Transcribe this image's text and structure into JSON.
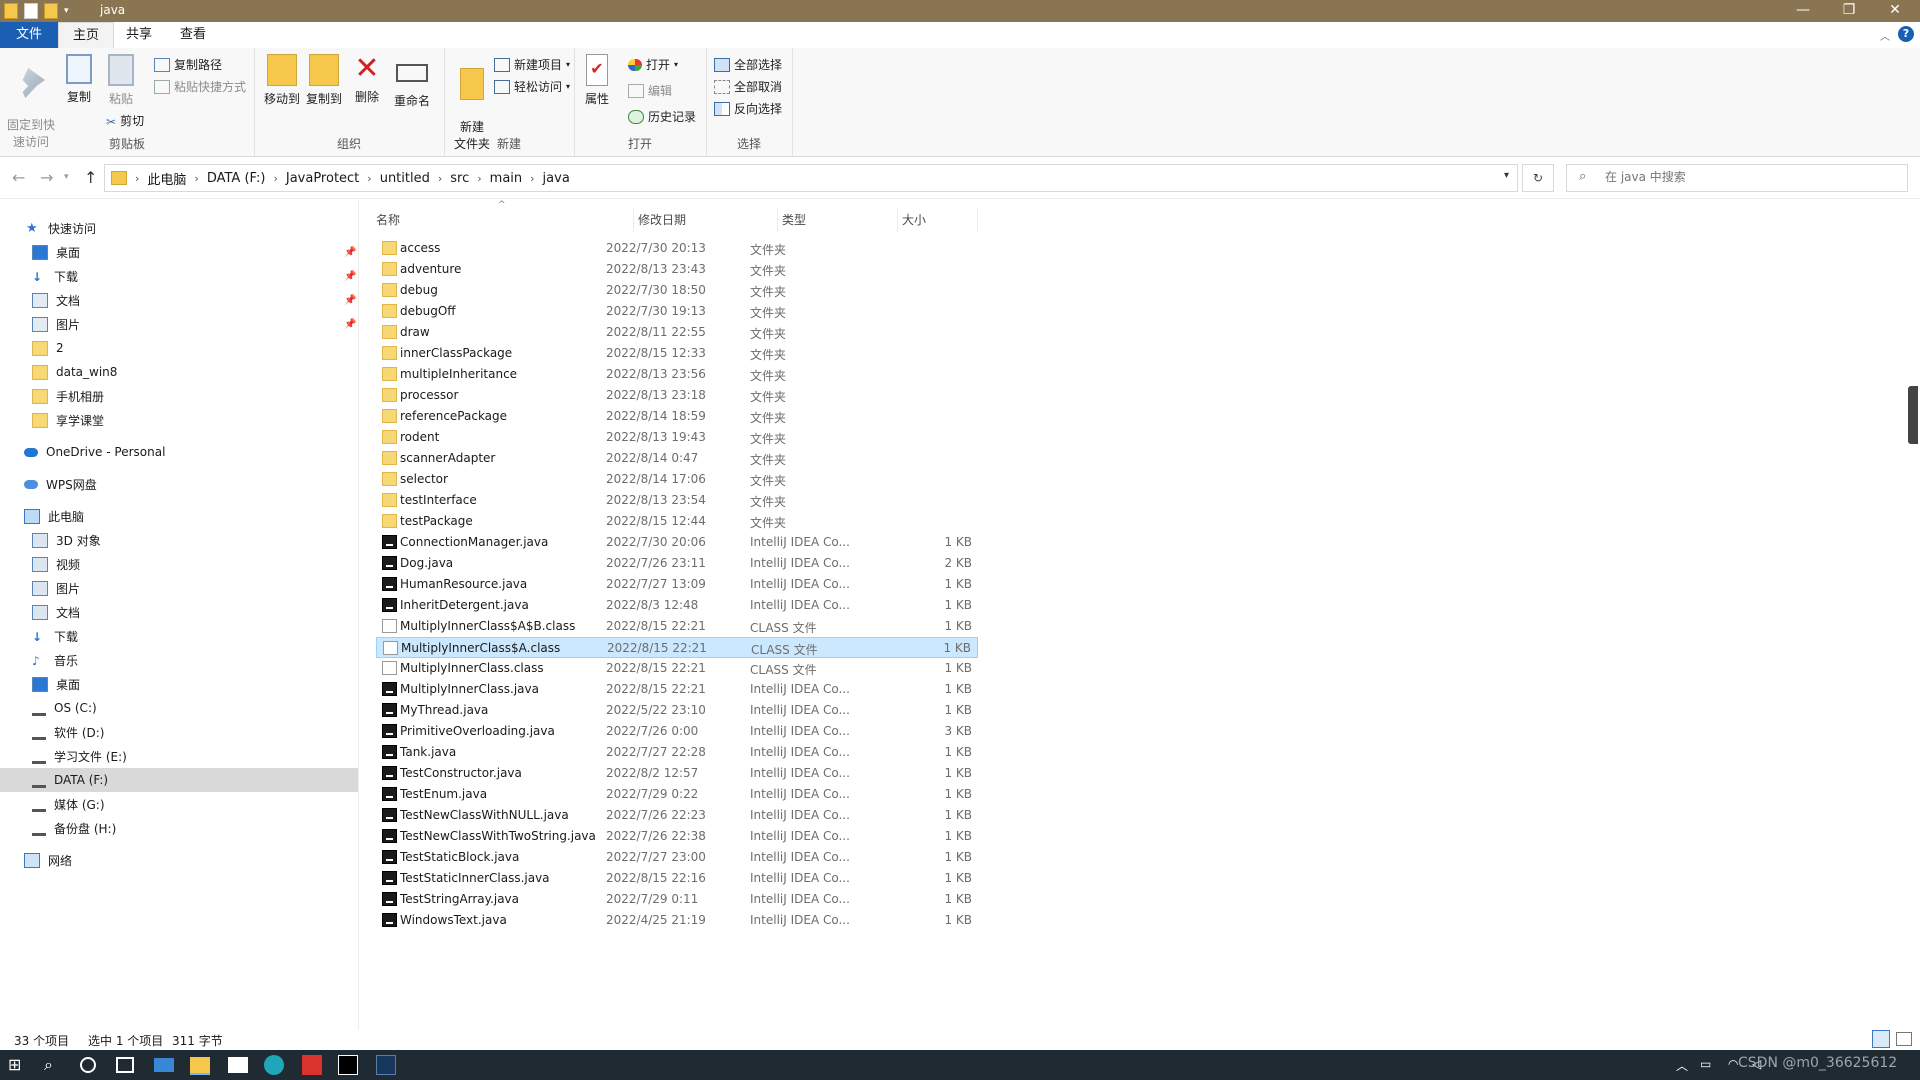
{
  "window": {
    "title": "java",
    "minimize": "—",
    "restore": "❐",
    "close": "✕"
  },
  "ribbon_tabs": [
    "文件",
    "主页",
    "共享",
    "查看"
  ],
  "ribbon": {
    "clipboard": {
      "pin": "固定到快\n速访问",
      "copy": "复制",
      "paste": "粘贴",
      "copy_path": "复制路径",
      "paste_shortcut": "粘贴快捷方式",
      "cut": "剪切",
      "label": "剪贴板"
    },
    "organize": {
      "move_to": "移动到",
      "copy_to": "复制到",
      "delete": "删除",
      "rename": "重命名",
      "label": "组织"
    },
    "new": {
      "new_folder": "新建\n文件夹",
      "new_item": "新建项目",
      "easy_access": "轻松访问",
      "label": "新建"
    },
    "open": {
      "properties": "属性",
      "open": "打开",
      "edit": "编辑",
      "history": "历史记录",
      "label": "打开"
    },
    "select": {
      "select_all": "全部选择",
      "select_none": "全部取消",
      "invert": "反向选择",
      "label": "选择"
    }
  },
  "breadcrumb": [
    "此电脑",
    "DATA (F:)",
    "JavaProtect",
    "untitled",
    "src",
    "main",
    "java"
  ],
  "search": {
    "placeholder": "在 java 中搜索"
  },
  "sidebar": {
    "quick_access": "快速访问",
    "quick_items": [
      "桌面",
      "下载",
      "文档",
      "图片",
      "2",
      "data_win8",
      "手机相册",
      "享学课堂"
    ],
    "onedrive": "OneDrive - Personal",
    "wps": "WPS网盘",
    "this_pc": "此电脑",
    "pc_items": [
      "3D 对象",
      "视频",
      "图片",
      "文档",
      "下载",
      "音乐",
      "桌面",
      "OS (C:)",
      "软件 (D:)",
      "学习文件 (E:)",
      "DATA (F:)",
      "媒体 (G:)",
      "备份盘 (H:)"
    ],
    "network": "网络"
  },
  "columns": {
    "name": "名称",
    "date": "修改日期",
    "type": "类型",
    "size": "大小"
  },
  "files": [
    {
      "name": "access",
      "date": "2022/7/30 20:13",
      "type": "文件夹",
      "size": "",
      "kind": "folder"
    },
    {
      "name": "adventure",
      "date": "2022/8/13 23:43",
      "type": "文件夹",
      "size": "",
      "kind": "folder"
    },
    {
      "name": "debug",
      "date": "2022/7/30 18:50",
      "type": "文件夹",
      "size": "",
      "kind": "folder"
    },
    {
      "name": "debugOff",
      "date": "2022/7/30 19:13",
      "type": "文件夹",
      "size": "",
      "kind": "folder"
    },
    {
      "name": "draw",
      "date": "2022/8/11 22:55",
      "type": "文件夹",
      "size": "",
      "kind": "folder"
    },
    {
      "name": "innerClassPackage",
      "date": "2022/8/15 12:33",
      "type": "文件夹",
      "size": "",
      "kind": "folder"
    },
    {
      "name": "multipleInheritance",
      "date": "2022/8/13 23:56",
      "type": "文件夹",
      "size": "",
      "kind": "folder"
    },
    {
      "name": "processor",
      "date": "2022/8/13 23:18",
      "type": "文件夹",
      "size": "",
      "kind": "folder"
    },
    {
      "name": "referencePackage",
      "date": "2022/8/14 18:59",
      "type": "文件夹",
      "size": "",
      "kind": "folder"
    },
    {
      "name": "rodent",
      "date": "2022/8/13 19:43",
      "type": "文件夹",
      "size": "",
      "kind": "folder"
    },
    {
      "name": "scannerAdapter",
      "date": "2022/8/14 0:47",
      "type": "文件夹",
      "size": "",
      "kind": "folder"
    },
    {
      "name": "selector",
      "date": "2022/8/14 17:06",
      "type": "文件夹",
      "size": "",
      "kind": "folder"
    },
    {
      "name": "testInterface",
      "date": "2022/8/13 23:54",
      "type": "文件夹",
      "size": "",
      "kind": "folder"
    },
    {
      "name": "testPackage",
      "date": "2022/8/15 12:44",
      "type": "文件夹",
      "size": "",
      "kind": "folder"
    },
    {
      "name": "ConnectionManager.java",
      "date": "2022/7/30 20:06",
      "type": "IntelliJ IDEA Co...",
      "size": "1 KB",
      "kind": "java"
    },
    {
      "name": "Dog.java",
      "date": "2022/7/26 23:11",
      "type": "IntelliJ IDEA Co...",
      "size": "2 KB",
      "kind": "java"
    },
    {
      "name": "HumanResource.java",
      "date": "2022/7/27 13:09",
      "type": "IntelliJ IDEA Co...",
      "size": "1 KB",
      "kind": "java"
    },
    {
      "name": "InheritDetergent.java",
      "date": "2022/8/3 12:48",
      "type": "IntelliJ IDEA Co...",
      "size": "1 KB",
      "kind": "java"
    },
    {
      "name": "MultiplyInnerClass$A$B.class",
      "date": "2022/8/15 22:21",
      "type": "CLASS 文件",
      "size": "1 KB",
      "kind": "class"
    },
    {
      "name": "MultiplyInnerClass$A.class",
      "date": "2022/8/15 22:21",
      "type": "CLASS 文件",
      "size": "1 KB",
      "kind": "class",
      "selected": true
    },
    {
      "name": "MultiplyInnerClass.class",
      "date": "2022/8/15 22:21",
      "type": "CLASS 文件",
      "size": "1 KB",
      "kind": "class"
    },
    {
      "name": "MultiplyInnerClass.java",
      "date": "2022/8/15 22:21",
      "type": "IntelliJ IDEA Co...",
      "size": "1 KB",
      "kind": "java"
    },
    {
      "name": "MyThread.java",
      "date": "2022/5/22 23:10",
      "type": "IntelliJ IDEA Co...",
      "size": "1 KB",
      "kind": "java"
    },
    {
      "name": "PrimitiveOverloading.java",
      "date": "2022/7/26 0:00",
      "type": "IntelliJ IDEA Co...",
      "size": "3 KB",
      "kind": "java"
    },
    {
      "name": "Tank.java",
      "date": "2022/7/27 22:28",
      "type": "IntelliJ IDEA Co...",
      "size": "1 KB",
      "kind": "java"
    },
    {
      "name": "TestConstructor.java",
      "date": "2022/8/2 12:57",
      "type": "IntelliJ IDEA Co...",
      "size": "1 KB",
      "kind": "java"
    },
    {
      "name": "TestEnum.java",
      "date": "2022/7/29 0:22",
      "type": "IntelliJ IDEA Co...",
      "size": "1 KB",
      "kind": "java"
    },
    {
      "name": "TestNewClassWithNULL.java",
      "date": "2022/7/26 22:23",
      "type": "IntelliJ IDEA Co...",
      "size": "1 KB",
      "kind": "java"
    },
    {
      "name": "TestNewClassWithTwoString.java",
      "date": "2022/7/26 22:38",
      "type": "IntelliJ IDEA Co...",
      "size": "1 KB",
      "kind": "java"
    },
    {
      "name": "TestStaticBlock.java",
      "date": "2022/7/27 23:00",
      "type": "IntelliJ IDEA Co...",
      "size": "1 KB",
      "kind": "java"
    },
    {
      "name": "TestStaticInnerClass.java",
      "date": "2022/8/15 22:16",
      "type": "IntelliJ IDEA Co...",
      "size": "1 KB",
      "kind": "java"
    },
    {
      "name": "TestStringArray.java",
      "date": "2022/7/29 0:11",
      "type": "IntelliJ IDEA Co...",
      "size": "1 KB",
      "kind": "java"
    },
    {
      "name": "WindowsText.java",
      "date": "2022/4/25 21:19",
      "type": "IntelliJ IDEA Co...",
      "size": "1 KB",
      "kind": "java"
    }
  ],
  "status": {
    "count": "33 个项目",
    "selected": "选中 1 个项目",
    "size": "311 字节"
  },
  "taskbar": {
    "tray_text": "CSDN @m0_36625612"
  },
  "colors": {
    "title_bar": "#8a7552",
    "accent": "#1a5fb4",
    "selection": "#cce8ff"
  }
}
